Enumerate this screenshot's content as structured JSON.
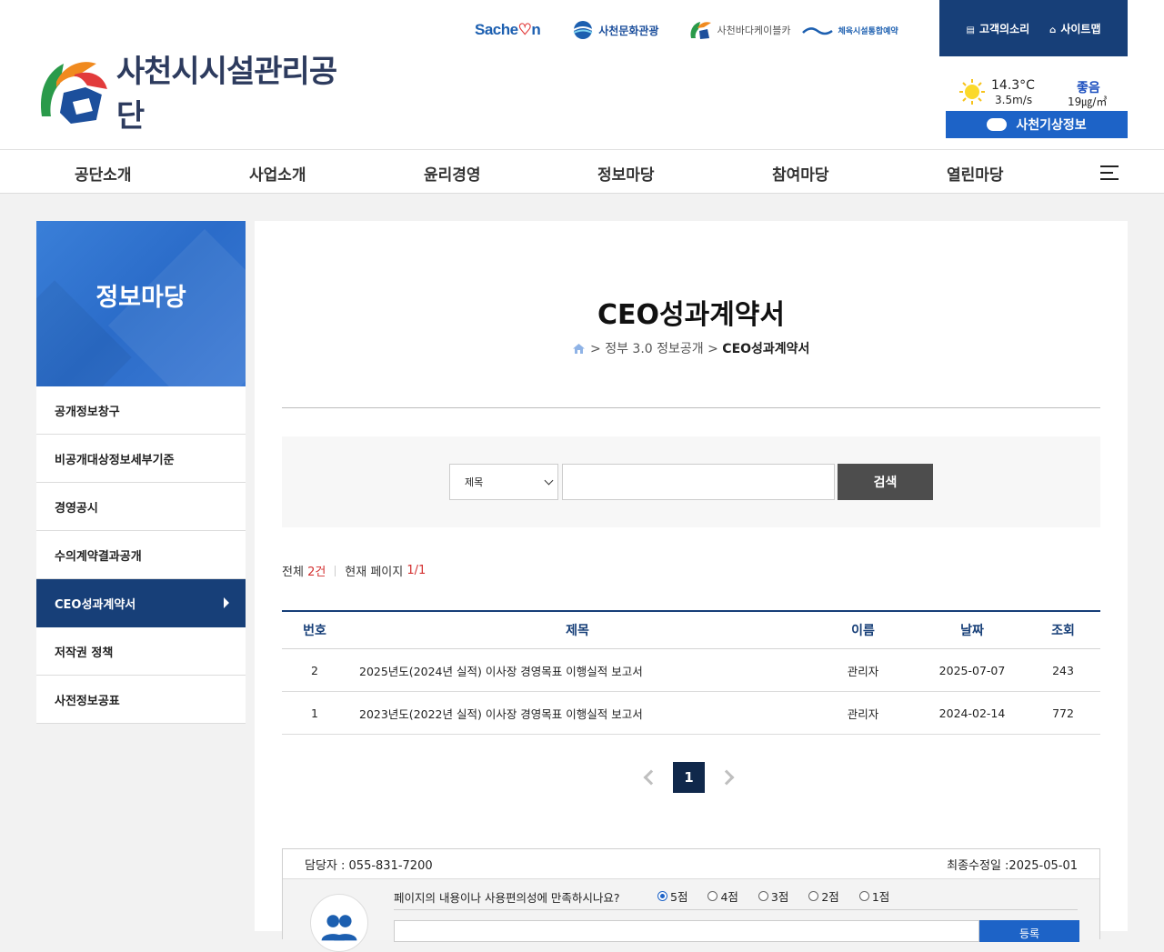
{
  "header": {
    "logo_text": "사천시시설관리공단",
    "partners": {
      "sacheon": "Sache",
      "sacheon_heart": "♡",
      "sacheon_end": "n",
      "culture": "사천문화관광",
      "cable": "사천바다케이블카",
      "sports": "체육시설통합예약"
    },
    "util": {
      "voice": "고객의소리",
      "sitemap": "사이트맵"
    },
    "weather": {
      "temp": "14.3°C",
      "wind": "3.5m/s",
      "air": "좋음",
      "pm": "19㎍/㎥",
      "button": "사천기상정보"
    }
  },
  "nav": {
    "items": [
      "공단소개",
      "사업소개",
      "윤리경영",
      "정보마당",
      "참여마당",
      "열린마당"
    ]
  },
  "sidebar": {
    "title": "정보마당",
    "items": [
      "공개정보창구",
      "비공개대상정보세부기준",
      "경영공시",
      "수의계약결과공개",
      "CEO성과계약서",
      "저작권 정책",
      "사전정보공표"
    ]
  },
  "page": {
    "title": "CEO성과계약서",
    "breadcrumb_sep": ">",
    "breadcrumb_1": "정부 3.0 정보공개",
    "breadcrumb_2": "CEO성과계약서"
  },
  "search": {
    "select_value": "제목",
    "input_value": "",
    "button": "검색"
  },
  "count": {
    "total_label": "전체",
    "total_value": "2건",
    "page_label": "현재 페이지",
    "page_value": "1/1"
  },
  "table": {
    "headers": {
      "num": "번호",
      "title": "제목",
      "name": "이름",
      "date": "날짜",
      "views": "조회"
    },
    "rows": [
      {
        "num": "2",
        "title": "2025년도(2024년 실적) 이사장 경영목표 이행실적 보고서",
        "name": "관리자",
        "date": "2025-07-07",
        "views": "243"
      },
      {
        "num": "1",
        "title": "2023년도(2022년 실적) 이사장 경영목표 이행실적 보고서",
        "name": "관리자",
        "date": "2024-02-14",
        "views": "772"
      }
    ]
  },
  "pagination": {
    "current": "1"
  },
  "footer_box": {
    "contact": "담당자 : 055-831-7200",
    "updated": "최종수정일 :2025-05-01",
    "question": "페이지의 내용이나 사용편의성에 만족하시나요?",
    "options": [
      "5점",
      "4점",
      "3점",
      "2점",
      "1점"
    ],
    "button": "등록"
  },
  "colors": {
    "navy": "#173f78",
    "accent_blue": "#1d63c7",
    "red": "#d32f2f"
  }
}
